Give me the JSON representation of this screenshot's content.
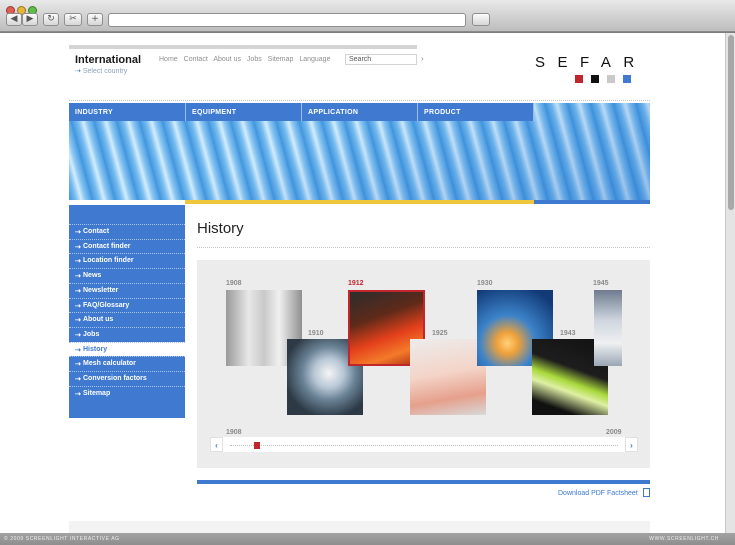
{
  "browser": {
    "nav_back": "◀",
    "nav_forward": "▶",
    "reload": "↻",
    "tab": "✂",
    "new_tab": "+",
    "url": "",
    "status_left": "© 2009 SCREENLIGHT INTERACTIVE AG",
    "status_right": "WWW.SCREENLIGHT.CH"
  },
  "header": {
    "title": "International",
    "select_country": "Select country",
    "nav": [
      "Home",
      "Contact",
      "About us",
      "Jobs",
      "Sitemap",
      "Language"
    ],
    "search_placeholder": "Search",
    "search_go": "›",
    "logo": "SEFAR",
    "logo_colors": [
      "#c0272d",
      "#111111",
      "#c9c9c9",
      "#3f79d0"
    ]
  },
  "menu": [
    "INDUSTRY",
    "EQUIPMENT",
    "APPLICATION",
    "PRODUCT"
  ],
  "sidebar": {
    "items": [
      "Contact",
      "Contact finder",
      "Location finder",
      "News",
      "Newsletter",
      "FAQ/Glossary",
      "About us",
      "Jobs",
      "History",
      "Mesh calculator",
      "Conversion factors",
      "Sitemap"
    ],
    "active": "History"
  },
  "main": {
    "title": "History",
    "timeline": {
      "years": [
        "1908",
        "1910",
        "1912",
        "1925",
        "1930",
        "1943",
        "1945"
      ],
      "highlighted_year": "1912",
      "slider_start": "1908",
      "slider_end": "2009",
      "slider_prev": "‹",
      "slider_next": "›"
    },
    "download_label": "Download PDF Factsheet"
  },
  "colors": {
    "brand_blue": "#3f79d0",
    "accent_red": "#c0272d",
    "accent_yellow": "#f0c63d"
  }
}
